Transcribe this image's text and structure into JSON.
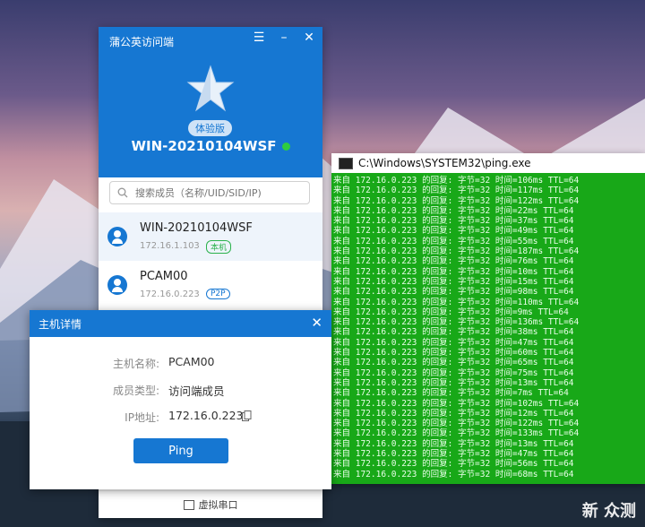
{
  "app": {
    "title": "蒲公英访问端",
    "badge": "体验版",
    "host": "WIN-20210104WSF",
    "search_placeholder": "搜索成员（名称/UID/SID/IP)",
    "members": [
      {
        "name": "WIN-20210104WSF",
        "ip": "172.16.1.103",
        "tag": "本机"
      },
      {
        "name": "PCAM00",
        "ip": "172.16.0.223",
        "tag": "P2P"
      }
    ],
    "footer": "虚拟串口",
    "status_color": "#2ecc40",
    "accent": "#1677d2"
  },
  "console": {
    "title": "C:\\Windows\\SYSTEM32\\ping.exe",
    "prefix": "来自 172.16.0.223 的回复: 字节=32 时间=",
    "lines": [
      "来自 172.16.0.223 的回复: 字节=32 时间=106ms TTL=64",
      "来自 172.16.0.223 的回复: 字节=32 时间=117ms TTL=64",
      "来自 172.16.0.223 的回复: 字节=32 时间=122ms TTL=64",
      "来自 172.16.0.223 的回复: 字节=32 时间=22ms TTL=64",
      "来自 172.16.0.223 的回复: 字节=32 时间=37ms TTL=64",
      "来自 172.16.0.223 的回复: 字节=32 时间=49ms TTL=64",
      "来自 172.16.0.223 的回复: 字节=32 时间=55ms TTL=64",
      "来自 172.16.0.223 的回复: 字节=32 时间=187ms TTL=64",
      "来自 172.16.0.223 的回复: 字节=32 时间=76ms TTL=64",
      "来自 172.16.0.223 的回复: 字节=32 时间=10ms TTL=64",
      "来自 172.16.0.223 的回复: 字节=32 时间=15ms TTL=64",
      "来自 172.16.0.223 的回复: 字节=32 时间=98ms TTL=64",
      "来自 172.16.0.223 的回复: 字节=32 时间=110ms TTL=64",
      "来自 172.16.0.223 的回复: 字节=32 时间=9ms TTL=64",
      "来自 172.16.0.223 的回复: 字节=32 时间=136ms TTL=64",
      "来自 172.16.0.223 的回复: 字节=32 时间=38ms TTL=64",
      "来自 172.16.0.223 的回复: 字节=32 时间=47ms TTL=64",
      "来自 172.16.0.223 的回复: 字节=32 时间=60ms TTL=64",
      "来自 172.16.0.223 的回复: 字节=32 时间=65ms TTL=64",
      "来自 172.16.0.223 的回复: 字节=32 时间=75ms TTL=64",
      "来自 172.16.0.223 的回复: 字节=32 时间=13ms TTL=64",
      "来自 172.16.0.223 的回复: 字节=32 时间=7ms TTL=64",
      "来自 172.16.0.223 的回复: 字节=32 时间=102ms TTL=64",
      "来自 172.16.0.223 的回复: 字节=32 时间=12ms TTL=64",
      "来自 172.16.0.223 的回复: 字节=32 时间=122ms TTL=64",
      "来自 172.16.0.223 的回复: 字节=32 时间=133ms TTL=64",
      "来自 172.16.0.223 的回复: 字节=32 时间=13ms TTL=64",
      "来自 172.16.0.223 的回复: 字节=32 时间=47ms TTL=64",
      "来自 172.16.0.223 的回复: 字节=32 时间=56ms TTL=64",
      "来自 172.16.0.223 的回复: 字节=32 时间=68ms TTL=64"
    ],
    "bg_color": "#18a818"
  },
  "dialog": {
    "title": "主机详情",
    "host_label": "主机名称:",
    "host_value": "PCAM00",
    "type_label": "成员类型:",
    "type_value": "访问端成员",
    "ip_label": "IP地址:",
    "ip_value": "172.16.0.223",
    "button": "Ping"
  },
  "watermark": "新 众测"
}
